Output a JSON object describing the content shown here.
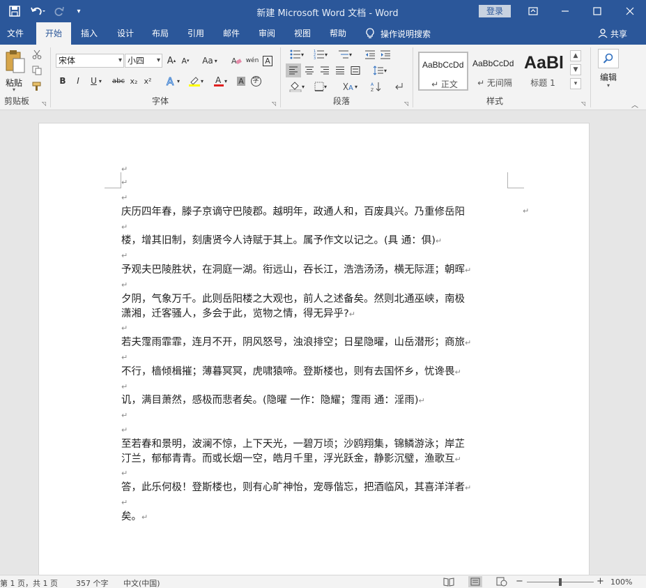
{
  "titlebar": {
    "doc_title": "新建 Microsoft Word 文档 - Word",
    "login": "登录",
    "icons": [
      "save-icon",
      "undo-icon",
      "redo-icon",
      "customize-icon",
      "ribbon-display-icon",
      "minimize-icon",
      "maximize-icon",
      "close-icon"
    ]
  },
  "tabs": [
    "文件",
    "开始",
    "插入",
    "设计",
    "布局",
    "引用",
    "邮件",
    "审阅",
    "视图",
    "帮助"
  ],
  "active_tab": "开始",
  "tell_me": "操作说明搜索",
  "share": "共享",
  "ribbon": {
    "clipboard": {
      "label": "剪贴板",
      "paste": "粘贴"
    },
    "font": {
      "label": "字体",
      "font_name": "宋体",
      "font_size": "小四",
      "aa_label": "Aa",
      "bold": "B",
      "italic": "I",
      "underline": "U",
      "strike": "abc",
      "sub": "x₂",
      "sup": "x²",
      "grow": "A",
      "shrink": "A",
      "clear": "A",
      "phonetic": "wén",
      "border_char": "A",
      "shade_char": "A",
      "circle_char": "字"
    },
    "paragraph": {
      "label": "段落"
    },
    "styles": {
      "label": "样式",
      "items": [
        {
          "preview": "AaBbCcDd",
          "name": "↵ 正文"
        },
        {
          "preview": "AaBbCcDd",
          "name": "↵ 无间隔"
        },
        {
          "preview": "AaBl",
          "name": "标题 1"
        }
      ]
    },
    "editing": {
      "label": "编辑"
    }
  },
  "document": {
    "paragraphs": [
      "庆历四年春，滕子京谪守巴陵郡。越明年，政通人和，百废具兴。乃重修岳阳",
      "楼，增其旧制，刻唐贤今人诗赋于其上。属予作文以记之。(具  通：俱)",
      "予观夫巴陵胜状，在洞庭一湖。衔远山，吞长江，浩浩汤汤，横无际涯；朝晖",
      "夕阴，气象万千。此则岳阳楼之大观也，前人之述备矣。然则北通巫峡，南极",
      "潇湘，迁客骚人，多会于此，览物之情，得无异乎?",
      "若夫霪雨霏霏，连月不开，阴风怒号，浊浪排空；日星隐曜，山岳潜形；商旅",
      "不行，樯倾楫摧；薄暮冥冥，虎啸猿啼。登斯楼也，则有去国怀乡，忧谗畏",
      "讥，满目萧然，感极而悲者矣。(隐曜  一作：隐耀；霪雨  通：淫雨)",
      "至若春和景明，波澜不惊，上下天光，一碧万顷；沙鸥翔集，锦鳞游泳；岸芷",
      "汀兰，郁郁青青。而或长烟一空，皓月千里，浮光跃金，静影沉璧，渔歌互",
      "答，此乐何极！登斯楼也，则有心旷神怡，宠辱偕忘，把酒临风，其喜洋洋者",
      "矣。"
    ],
    "paragraph_mark": "↵"
  },
  "statusbar": {
    "page": "第 1 页，共 1 页",
    "words": "357 个字",
    "language": "中文(中国)",
    "zoom": "100%",
    "zoom_level": 0.5
  }
}
